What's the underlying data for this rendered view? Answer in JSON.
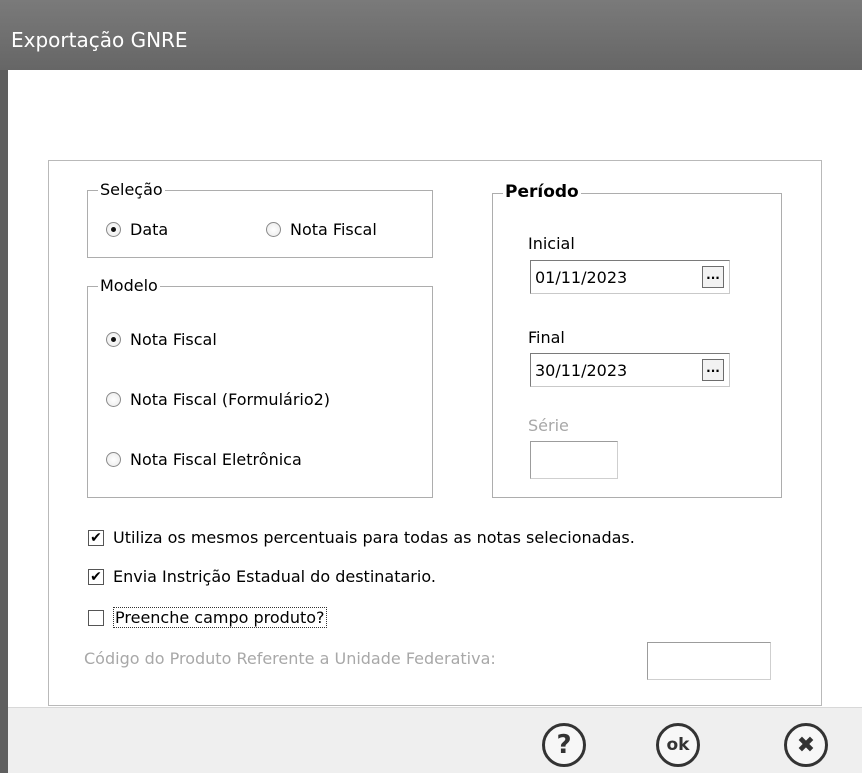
{
  "window": {
    "title": "Exportação GNRE"
  },
  "selecao": {
    "legend": "Seleção",
    "options": [
      {
        "label": "Data",
        "selected": true
      },
      {
        "label": "Nota Fiscal",
        "selected": false
      }
    ]
  },
  "modelo": {
    "legend": "Modelo",
    "options": [
      {
        "label": "Nota Fiscal",
        "selected": true
      },
      {
        "label": "Nota Fiscal (Formulário2)",
        "selected": false
      },
      {
        "label": "Nota Fiscal Eletrônica",
        "selected": false
      }
    ]
  },
  "periodo": {
    "legend": "Período",
    "inicial_label": "Inicial",
    "inicial_value": "01/11/2023",
    "final_label": "Final",
    "final_value": "30/11/2023",
    "ellipsis": "...",
    "serie_label": "Série",
    "serie_value": ""
  },
  "options": {
    "mesmos_percentuais": {
      "label": "Utiliza os mesmos percentuais para todas as notas selecionadas.",
      "checked": true,
      "mark": "✔"
    },
    "envia_ie": {
      "label": "Envia Instrição Estadual do destinatario.",
      "checked": true,
      "mark": "✔"
    },
    "preenche_produto": {
      "label": "Preenche campo produto?",
      "checked": false,
      "mark": ""
    }
  },
  "codigo_produto": {
    "label": "Código do Produto Referente a Unidade Federativa:",
    "value": ""
  },
  "footer": {
    "help": {
      "icon": "help-icon",
      "glyph": "?"
    },
    "ok": {
      "icon": "ok-icon",
      "glyph": "ok"
    },
    "cancel": {
      "icon": "close-icon",
      "glyph": "✖"
    }
  }
}
